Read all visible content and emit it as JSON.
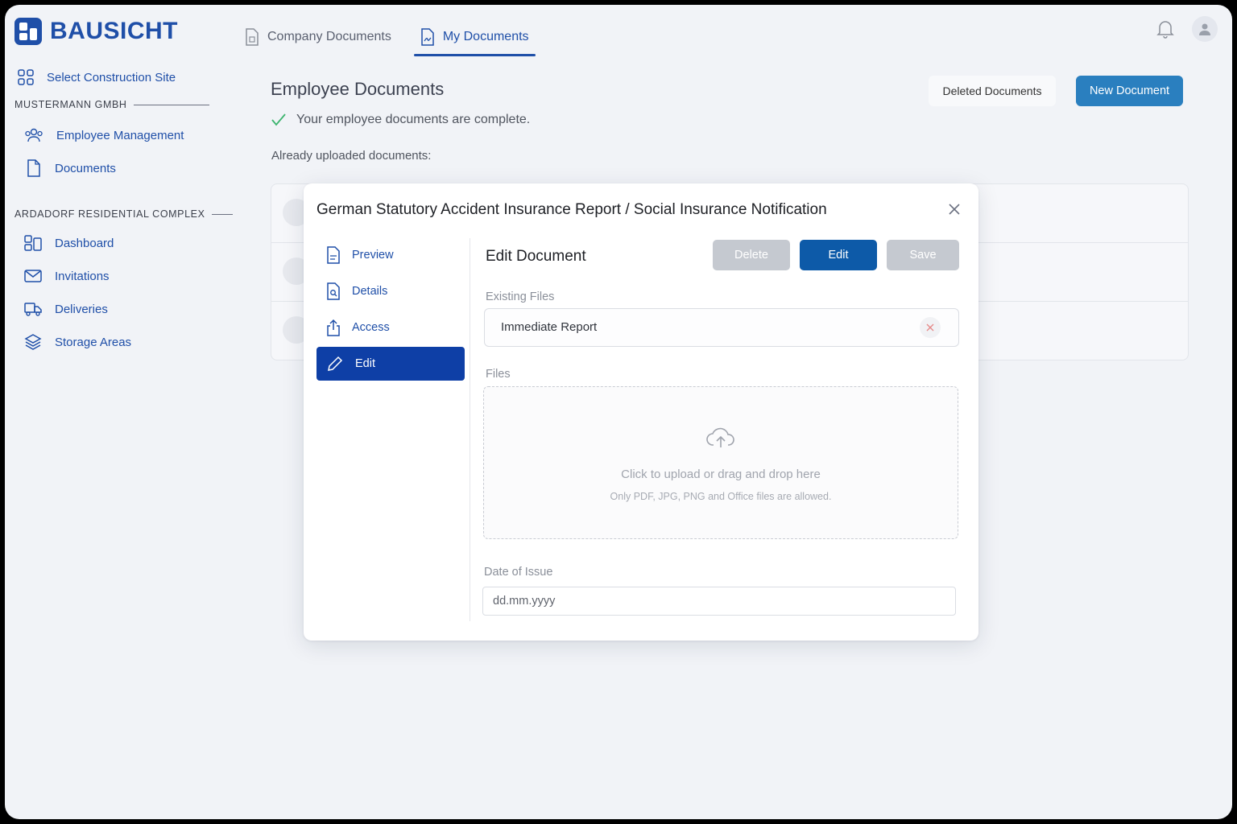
{
  "app": {
    "logo_text": "BAUSICHT"
  },
  "topnav": {
    "tabs": [
      {
        "label": "Company Documents",
        "icon": "file-icon",
        "active": false
      },
      {
        "label": "My Documents",
        "icon": "file-signature-icon",
        "active": true
      }
    ]
  },
  "sidebar": {
    "select_site": "Select Construction Site",
    "company_section": "MUSTERMANN GMBH",
    "company_items": [
      "Employee Management",
      "Documents"
    ],
    "project_section": "ARDADORF RESIDENTIAL COMPLEX",
    "project_items": [
      "Dashboard",
      "Invitations",
      "Deliveries",
      "Storage Areas"
    ]
  },
  "main": {
    "title": "Employee Documents",
    "complete_message": "Your employee documents are complete.",
    "uploaded_label": "Already uploaded documents:",
    "deleted_button": "Deleted Documents",
    "new_button": "New Document"
  },
  "modal": {
    "title": "German Statutory Accident Insurance Report / Social Insurance Notification",
    "nav": [
      "Preview",
      "Details",
      "Access",
      "Edit"
    ],
    "active_nav": "Edit",
    "edit_heading": "Edit Document",
    "buttons": {
      "delete": "Delete",
      "edit": "Edit",
      "save": "Save"
    },
    "existing_files_label": "Existing Files",
    "existing_file": "Immediate Report",
    "files_label": "Files",
    "upload_text": "Click to upload or drag and drop here",
    "upload_hint": "Only PDF, JPG, PNG and Office files are allowed.",
    "date_label": "Date of Issue",
    "date_placeholder": "dd.mm.yyyy"
  },
  "colors": {
    "brand": "#1f4fa8",
    "primary_button": "#0d5aa8",
    "active_nav": "#0e3fa6",
    "success": "#3cb46e"
  }
}
